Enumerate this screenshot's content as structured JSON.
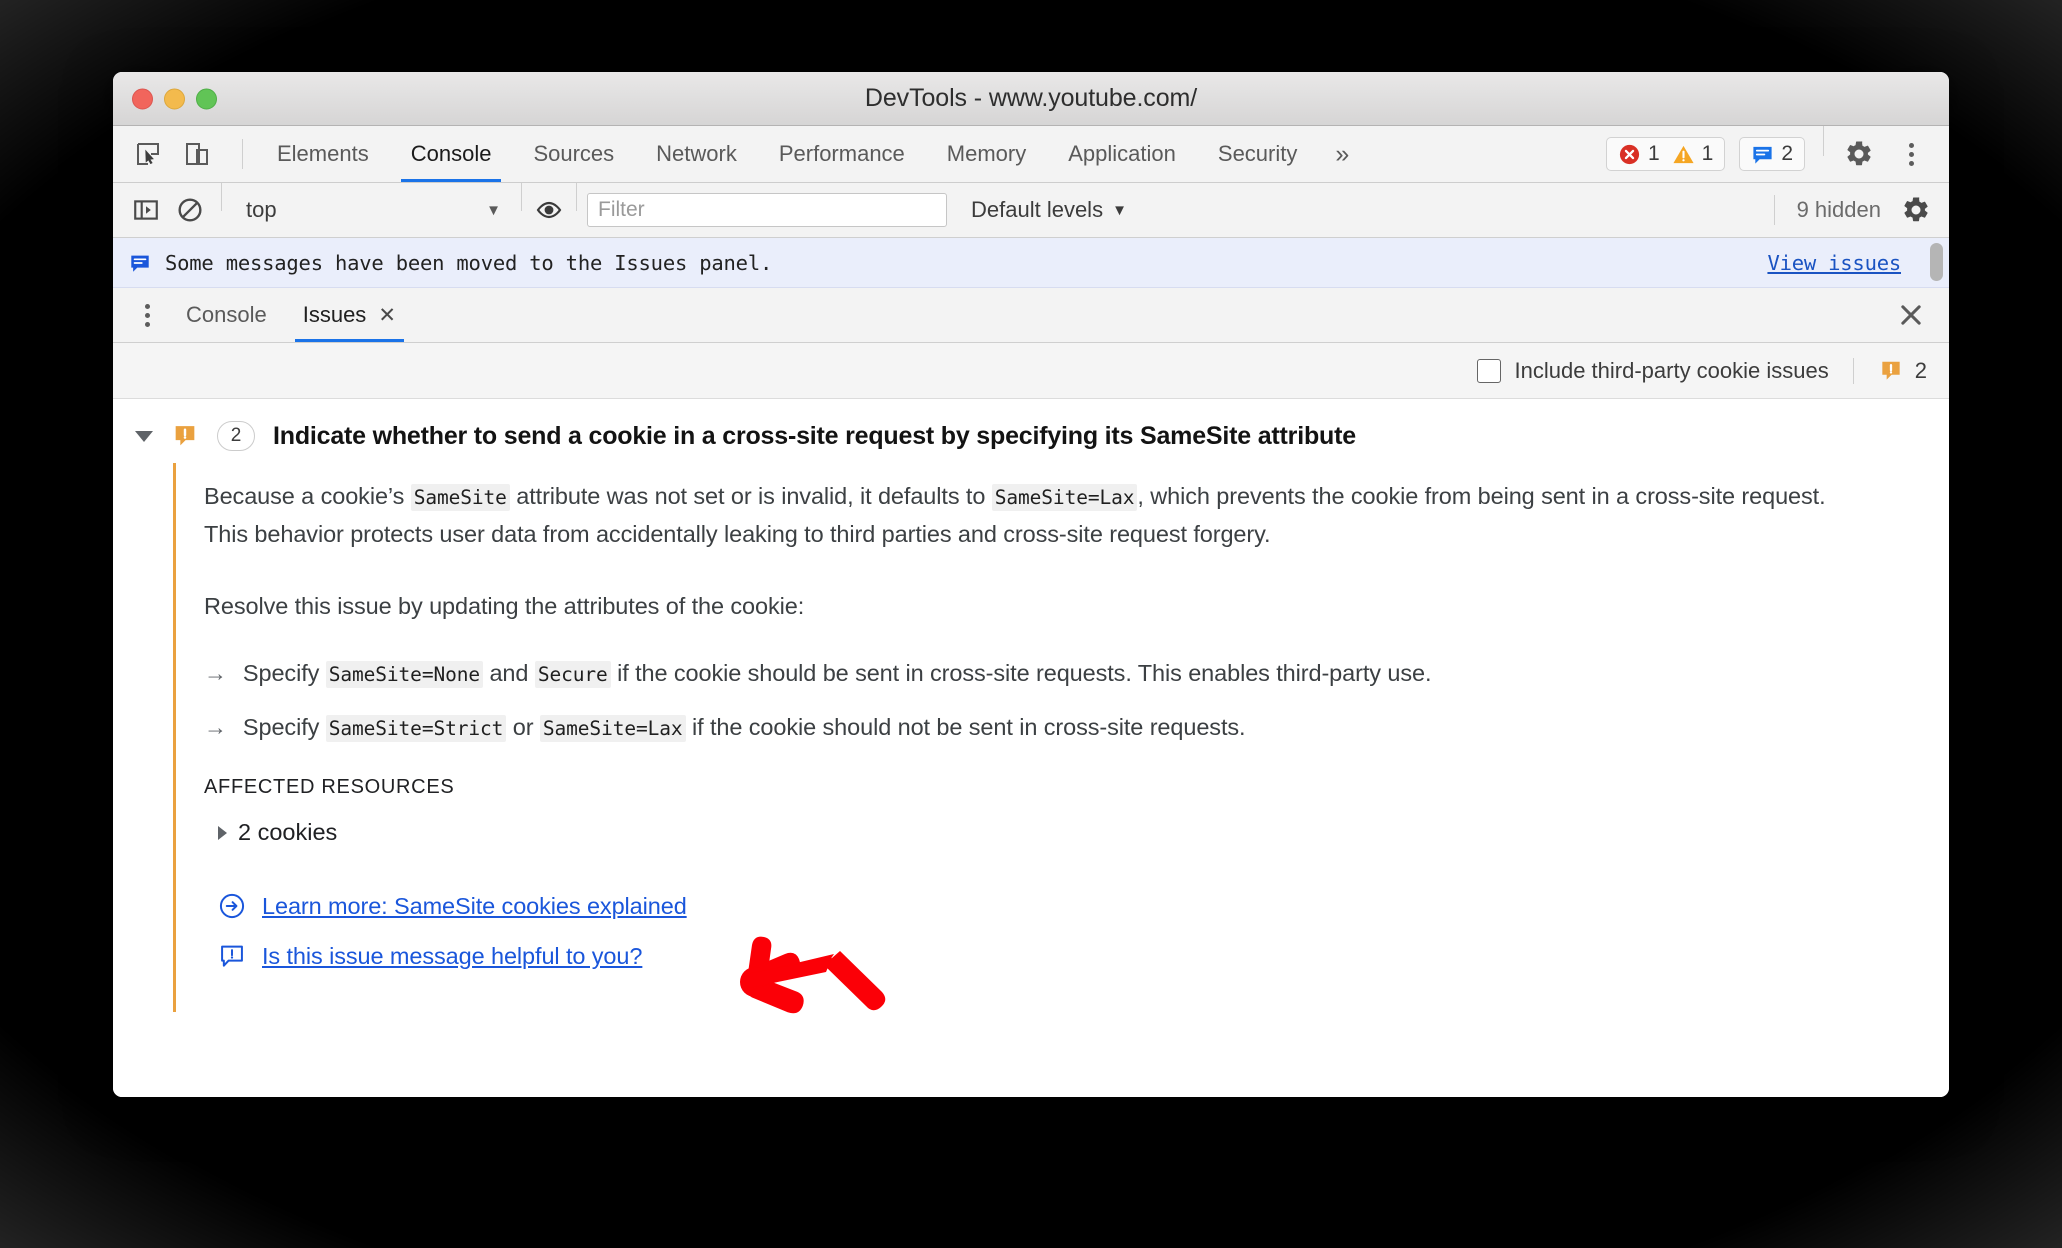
{
  "window": {
    "title": "DevTools - www.youtube.com/",
    "traffic_lights": [
      "close",
      "minimize",
      "zoom"
    ]
  },
  "main_tabs": {
    "inspect_icon": "inspect-element-icon",
    "device_icon": "device-toolbar-icon",
    "items": [
      {
        "label": "Elements",
        "active": false
      },
      {
        "label": "Console",
        "active": true
      },
      {
        "label": "Sources",
        "active": false
      },
      {
        "label": "Network",
        "active": false
      },
      {
        "label": "Performance",
        "active": false
      },
      {
        "label": "Memory",
        "active": false
      },
      {
        "label": "Application",
        "active": false
      },
      {
        "label": "Security",
        "active": false
      }
    ],
    "more_label": "»",
    "error_count": "1",
    "warning_count": "1",
    "issue_count": "2",
    "settings_icon": "gear-icon",
    "more_icon": "kebab-menu-icon"
  },
  "filterbar": {
    "sidebar_icon": "console-sidebar-icon",
    "clear_icon": "clear-console-icon",
    "context_value": "top",
    "context_caret": "▼",
    "eye_icon": "live-expression-eye-icon",
    "filter_placeholder": "Filter",
    "filter_value": "",
    "levels_label": "Default levels",
    "levels_caret": "▼",
    "hidden_label": "9 hidden",
    "settings_icon": "console-settings-gear-icon"
  },
  "console_message": {
    "icon": "issue-message-icon",
    "text": "Some messages have been moved to the Issues panel.",
    "link": "View issues"
  },
  "drawer": {
    "kebab_icon": "drawer-more-options-icon",
    "tabs": [
      {
        "label": "Console",
        "active": false,
        "closable": false
      },
      {
        "label": "Issues",
        "active": true,
        "closable": true,
        "close_glyph": "✕"
      }
    ],
    "close_glyph": "✕"
  },
  "issues_toolbar": {
    "checkbox_label": "Include third-party cookie issues",
    "checkbox_checked": false,
    "warning_icon": "orange-issue-bubble-icon",
    "count": "2"
  },
  "issue": {
    "expanded": true,
    "severity_icon": "orange-issue-bubble-icon",
    "count_badge": "2",
    "title": "Indicate whether to send a cookie in a cross-site request by specifying its SameSite attribute",
    "paragraph_1": {
      "part_1": "Because a cookie’s ",
      "code_1": "SameSite",
      "part_2": " attribute was not set or is invalid, it defaults to ",
      "code_2": "SameSite=Lax",
      "part_3": ", which prevents the cookie from being sent in a cross-site request. This behavior protects user data from accidentally leaking to third parties and cross-site request forgery."
    },
    "paragraph_2": "Resolve this issue by updating the attributes of the cookie:",
    "bullets": [
      {
        "marker": "→",
        "part_1": "Specify ",
        "code_1": "SameSite=None",
        "part_2": " and ",
        "code_2": "Secure",
        "part_3": " if the cookie should be sent in cross-site requests. This enables third-party use."
      },
      {
        "marker": "→",
        "part_1": "Specify ",
        "code_1": "SameSite=Strict",
        "part_2": " or ",
        "code_2": "SameSite=Lax",
        "part_3": " if the cookie should not be sent in cross-site requests."
      }
    ],
    "affected_resources_title": "AFFECTED RESOURCES",
    "affected_resource": "2 cookies",
    "links": [
      {
        "icon": "arrow-circle-right-icon",
        "label": "Learn more: SameSite cookies explained"
      },
      {
        "icon": "feedback-bubble-icon",
        "label": "Is this issue message helpful to you?"
      }
    ]
  },
  "annotation": {
    "arrow_icon": "red-pointer-arrow",
    "color": "#fb0007"
  },
  "colors": {
    "accent_blue": "#1a73e8",
    "link_blue": "#1a56db",
    "issue_orange": "#eaa13f",
    "error_red": "#d93025",
    "warning_orange": "#f5a623",
    "annotation_red": "#fb0007"
  }
}
